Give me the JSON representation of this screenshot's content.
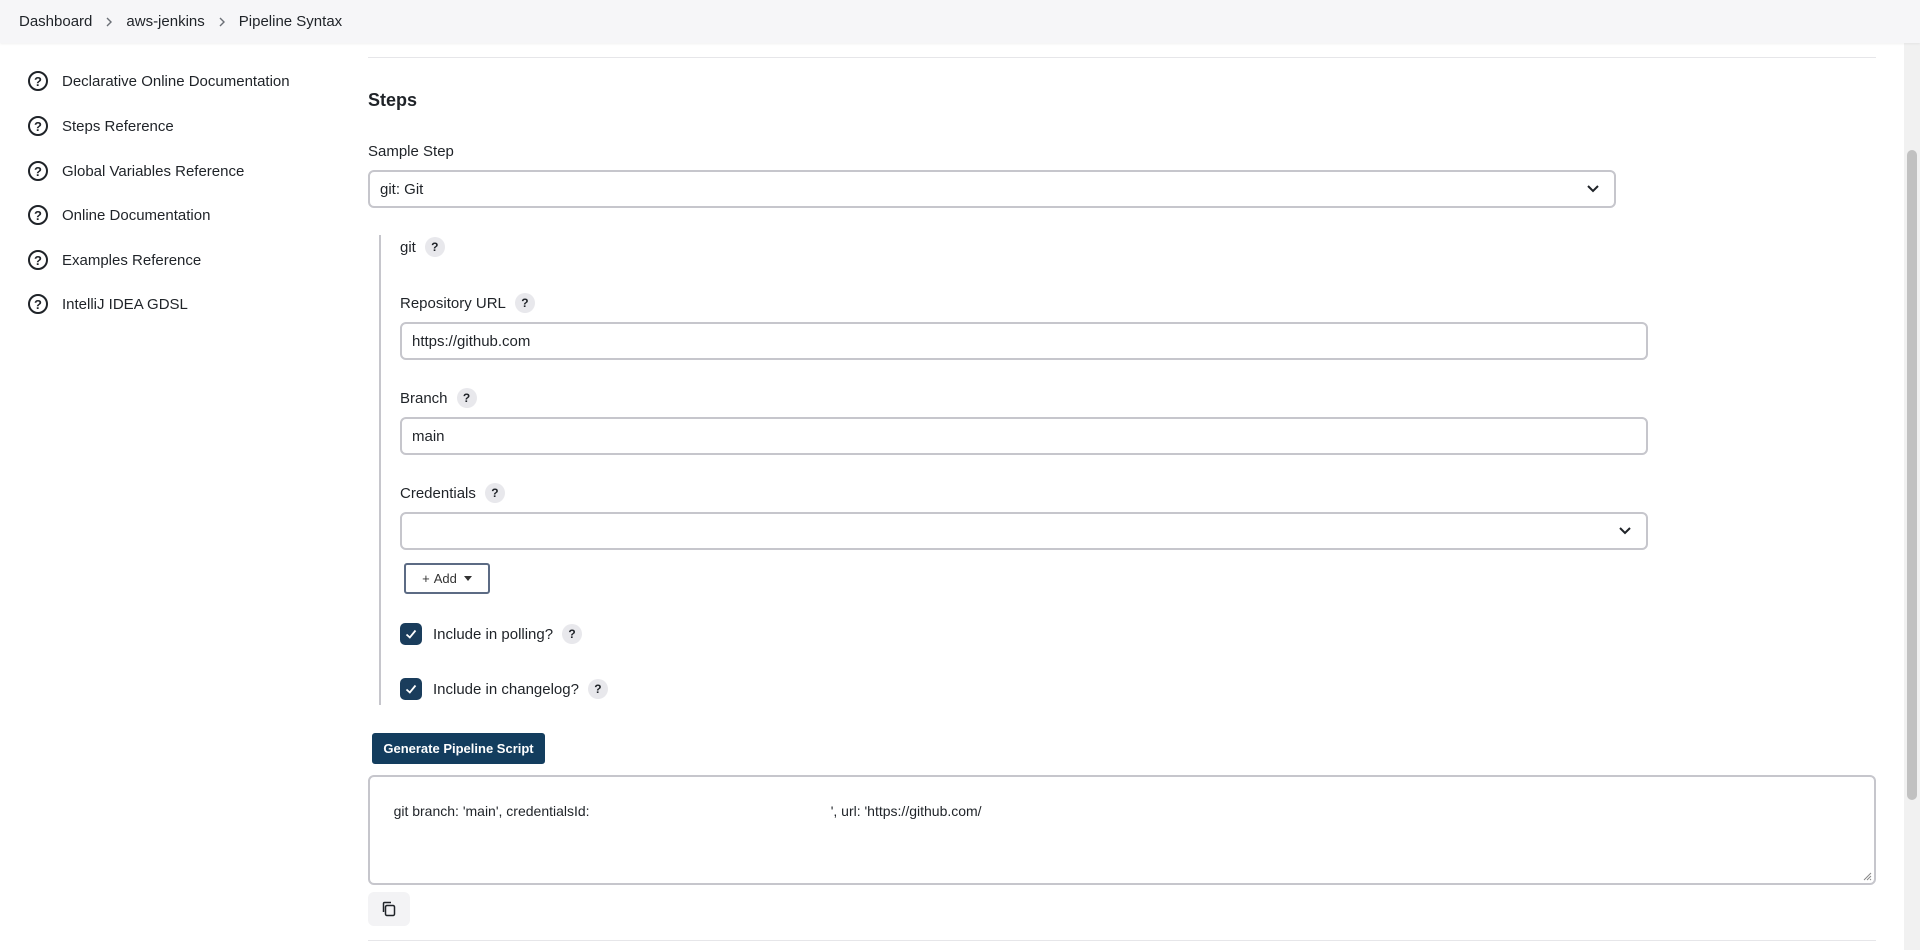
{
  "breadcrumb": {
    "items": [
      "Dashboard",
      "aws-jenkins",
      "Pipeline Syntax"
    ]
  },
  "sidebar": {
    "items": [
      {
        "label": "Declarative Online Documentation",
        "icon": "help-circle-icon"
      },
      {
        "label": "Steps Reference",
        "icon": "help-circle-icon"
      },
      {
        "label": "Global Variables Reference",
        "icon": "help-circle-icon"
      },
      {
        "label": "Online Documentation",
        "icon": "help-circle-icon"
      },
      {
        "label": "Examples Reference",
        "icon": "help-circle-icon"
      },
      {
        "label": "IntelliJ IDEA GDSL",
        "icon": "help-circle-icon"
      }
    ]
  },
  "main": {
    "section_title": "Steps",
    "sample_step": {
      "label": "Sample Step",
      "value": "git: Git"
    },
    "git": {
      "label": "git",
      "repo_url": {
        "label": "Repository URL",
        "value": "https://github.com"
      },
      "branch": {
        "label": "Branch",
        "value": "main"
      },
      "credentials": {
        "label": "Credentials",
        "value": ""
      },
      "add_label": "Add",
      "include_polling": {
        "label": "Include in polling?",
        "checked": true
      },
      "include_changelog": {
        "label": "Include in changelog?",
        "checked": true
      }
    },
    "generate_label": "Generate Pipeline Script",
    "script_output": "git branch: 'main', credentialsId:                                                              ', url: 'https://github.com/"
  },
  "icons": {
    "help": "?",
    "add_prefix": "+"
  },
  "colors": {
    "primary_button": "#133d5e",
    "checkbox": "#1a3d5c",
    "border": "#c6c6cc"
  }
}
